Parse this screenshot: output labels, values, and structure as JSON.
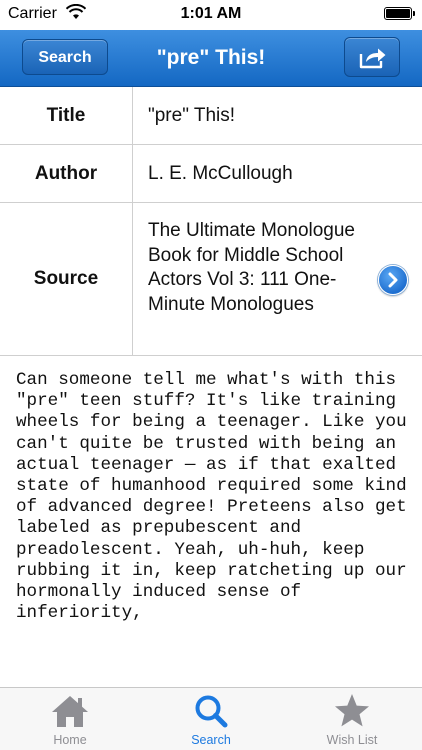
{
  "status_bar": {
    "carrier": "Carrier",
    "time": "1:01 AM",
    "battery_level": 1.0
  },
  "nav": {
    "back_label": "Search",
    "title": "\"pre\" This!",
    "share_icon": "share-icon"
  },
  "details": {
    "rows": [
      {
        "label": "Title",
        "value": "\"pre\" This!"
      },
      {
        "label": "Author",
        "value": "L. E. McCullough"
      },
      {
        "label": "Source",
        "value": "The Ultimate Monologue Book for Middle School Actors Vol 3: 111 One-Minute Monologues"
      }
    ]
  },
  "monologue": {
    "text": "Can someone tell me what's with this \"pre\" teen stuff? It's like training wheels for being a teenager. Like you can't quite be trusted with being an actual teenager — as if that exalted state of humanhood required some kind of advanced degree! Preteens also get labeled as prepubescent and preadolescent. Yeah, uh-huh, keep rubbing it in, keep ratcheting up our hormonally induced sense of inferiority,"
  },
  "tab_bar": {
    "tabs": [
      {
        "label": "Home",
        "icon": "home-icon",
        "active": false
      },
      {
        "label": "Search",
        "icon": "search-icon",
        "active": true
      },
      {
        "label": "Wish List",
        "icon": "star-icon",
        "active": false
      }
    ]
  },
  "colors": {
    "nav_gradient_top": "#3e8fe0",
    "nav_gradient_bottom": "#1468c3",
    "active_tab": "#1d7ae0",
    "inactive_tab": "#8e8e93"
  }
}
